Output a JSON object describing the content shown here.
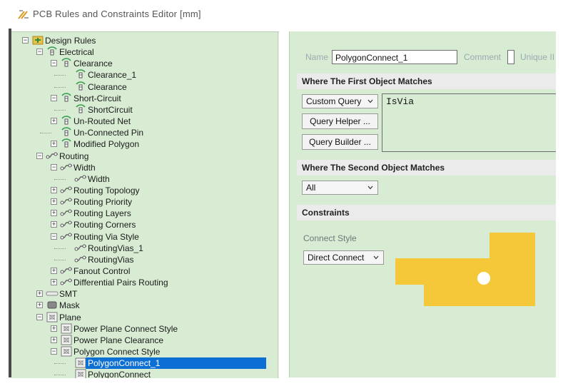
{
  "window": {
    "title": "PCB Rules and Constraints Editor [mm]"
  },
  "tree": [
    {
      "label": "Design Rules",
      "level": 0,
      "expander": "minus",
      "icon": "design-rules-icon"
    },
    {
      "label": "Electrical",
      "level": 1,
      "expander": "minus",
      "icon": "rule-icon"
    },
    {
      "label": "Clearance",
      "level": 2,
      "expander": "minus",
      "icon": "rule-icon"
    },
    {
      "label": "Clearance_1",
      "level": 3,
      "expander": "",
      "icon": "rule-icon"
    },
    {
      "label": "Clearance",
      "level": 3,
      "expander": "",
      "icon": "rule-icon"
    },
    {
      "label": "Short-Circuit",
      "level": 2,
      "expander": "minus",
      "icon": "rule-icon"
    },
    {
      "label": "ShortCircuit",
      "level": 3,
      "expander": "",
      "icon": "rule-icon"
    },
    {
      "label": "Un-Routed Net",
      "level": 2,
      "expander": "plus",
      "icon": "rule-icon"
    },
    {
      "label": "Un-Connected Pin",
      "level": 2,
      "expander": "",
      "icon": "rule-icon"
    },
    {
      "label": "Modified Polygon",
      "level": 2,
      "expander": "plus",
      "icon": "rule-icon"
    },
    {
      "label": "Routing",
      "level": 1,
      "expander": "minus",
      "icon": "routing-icon"
    },
    {
      "label": "Width",
      "level": 2,
      "expander": "minus",
      "icon": "routing-icon"
    },
    {
      "label": "Width",
      "level": 3,
      "expander": "",
      "icon": "routing-icon"
    },
    {
      "label": "Routing Topology",
      "level": 2,
      "expander": "plus",
      "icon": "routing-icon"
    },
    {
      "label": "Routing Priority",
      "level": 2,
      "expander": "plus",
      "icon": "routing-icon"
    },
    {
      "label": "Routing Layers",
      "level": 2,
      "expander": "plus",
      "icon": "routing-icon"
    },
    {
      "label": "Routing Corners",
      "level": 2,
      "expander": "plus",
      "icon": "routing-icon"
    },
    {
      "label": "Routing Via Style",
      "level": 2,
      "expander": "minus",
      "icon": "routing-icon"
    },
    {
      "label": "RoutingVias_1",
      "level": 3,
      "expander": "",
      "icon": "routing-icon"
    },
    {
      "label": "RoutingVias",
      "level": 3,
      "expander": "",
      "icon": "routing-icon"
    },
    {
      "label": "Fanout Control",
      "level": 2,
      "expander": "plus",
      "icon": "routing-icon"
    },
    {
      "label": "Differential Pairs Routing",
      "level": 2,
      "expander": "plus",
      "icon": "routing-icon"
    },
    {
      "label": "SMT",
      "level": 1,
      "expander": "plus",
      "icon": "smt-icon"
    },
    {
      "label": "Mask",
      "level": 1,
      "expander": "plus",
      "icon": "mask-icon"
    },
    {
      "label": "Plane",
      "level": 1,
      "expander": "minus",
      "icon": "plane-icon"
    },
    {
      "label": "Power Plane Connect Style",
      "level": 2,
      "expander": "plus",
      "icon": "plane-icon"
    },
    {
      "label": "Power Plane Clearance",
      "level": 2,
      "expander": "plus",
      "icon": "plane-icon"
    },
    {
      "label": "Polygon Connect Style",
      "level": 2,
      "expander": "minus",
      "icon": "plane-icon"
    },
    {
      "label": "PolygonConnect_1",
      "level": 3,
      "expander": "",
      "icon": "plane-icon",
      "selected": true
    },
    {
      "label": "PolygonConnect",
      "level": 3,
      "expander": "",
      "icon": "plane-icon"
    }
  ],
  "rule": {
    "name_label": "Name",
    "name_value": "PolygonConnect_1",
    "comment_label": "Comment",
    "unique_label": "Unique II"
  },
  "first_match": {
    "header": "Where The First Object Matches",
    "combo": "Custom Query",
    "query_helper": "Query Helper ...",
    "query_builder": "Query Builder ...",
    "query": "IsVia"
  },
  "second_match": {
    "header": "Where The Second Object Matches",
    "combo": "All"
  },
  "constraints": {
    "header": "Constraints",
    "connect_style_label": "Connect Style",
    "connect_style_value": "Direct Connect",
    "shape_color": "#f5c83a"
  }
}
